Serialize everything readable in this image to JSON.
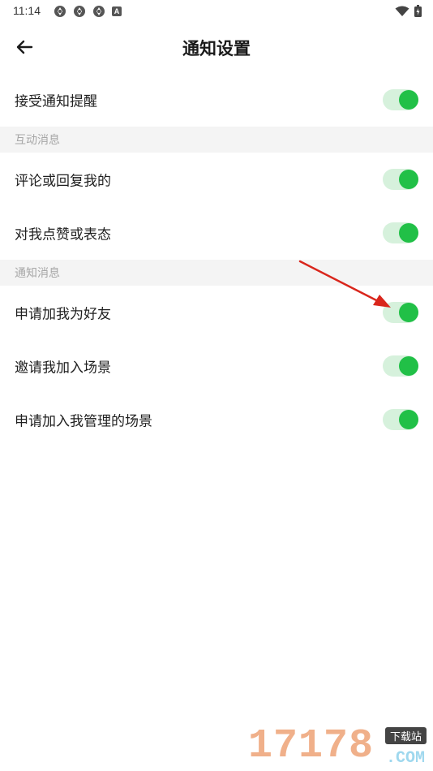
{
  "status_bar": {
    "time": "11:14",
    "notification_icons": [
      "sync-icon",
      "sync-icon",
      "sync-icon",
      "a-icon"
    ],
    "a_badge": "A"
  },
  "header": {
    "title": "通知设置"
  },
  "rows": {
    "receive_notifications": {
      "label": "接受通知提醒",
      "enabled": true
    },
    "comment_reply": {
      "label": "评论或回复我的",
      "enabled": true
    },
    "like_react": {
      "label": "对我点赞或表态",
      "enabled": true
    },
    "friend_request": {
      "label": "申请加我为好友",
      "enabled": true
    },
    "scene_invite": {
      "label": "邀请我加入场景",
      "enabled": true
    },
    "join_managed_scene": {
      "label": "申请加入我管理的场景",
      "enabled": true
    }
  },
  "sections": {
    "interaction": "互动消息",
    "notification": "通知消息"
  },
  "colors": {
    "toggle_track": "#d6f1dc",
    "toggle_knob": "#21c047",
    "section_bg": "#f4f4f4",
    "section_text": "#a6a6a6",
    "annotation_arrow": "#d9261c"
  },
  "watermark": {
    "digits": "17178",
    "tag": "下载站",
    "suffix": ".COM"
  }
}
